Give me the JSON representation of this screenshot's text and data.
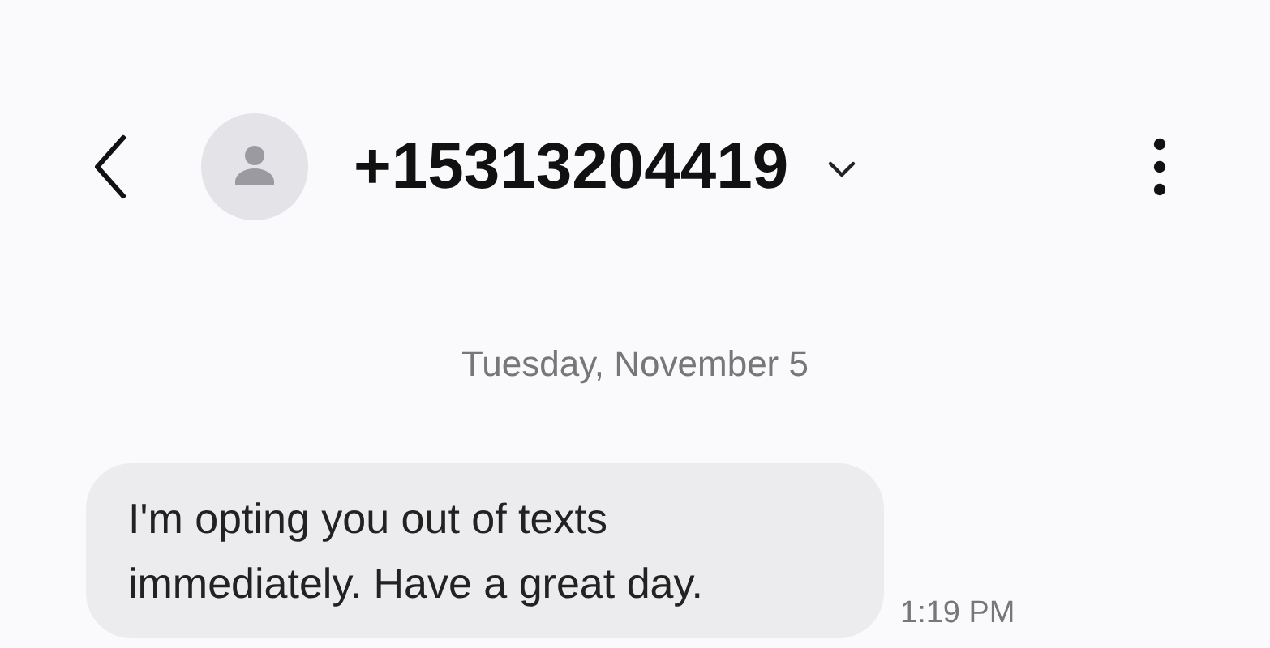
{
  "header": {
    "contact": "+15313204419"
  },
  "date_divider": "Tuesday, November 5",
  "messages": [
    {
      "text": "I'm opting you out of texts immediately. Have a great day.",
      "time": "1:19 PM"
    }
  ]
}
